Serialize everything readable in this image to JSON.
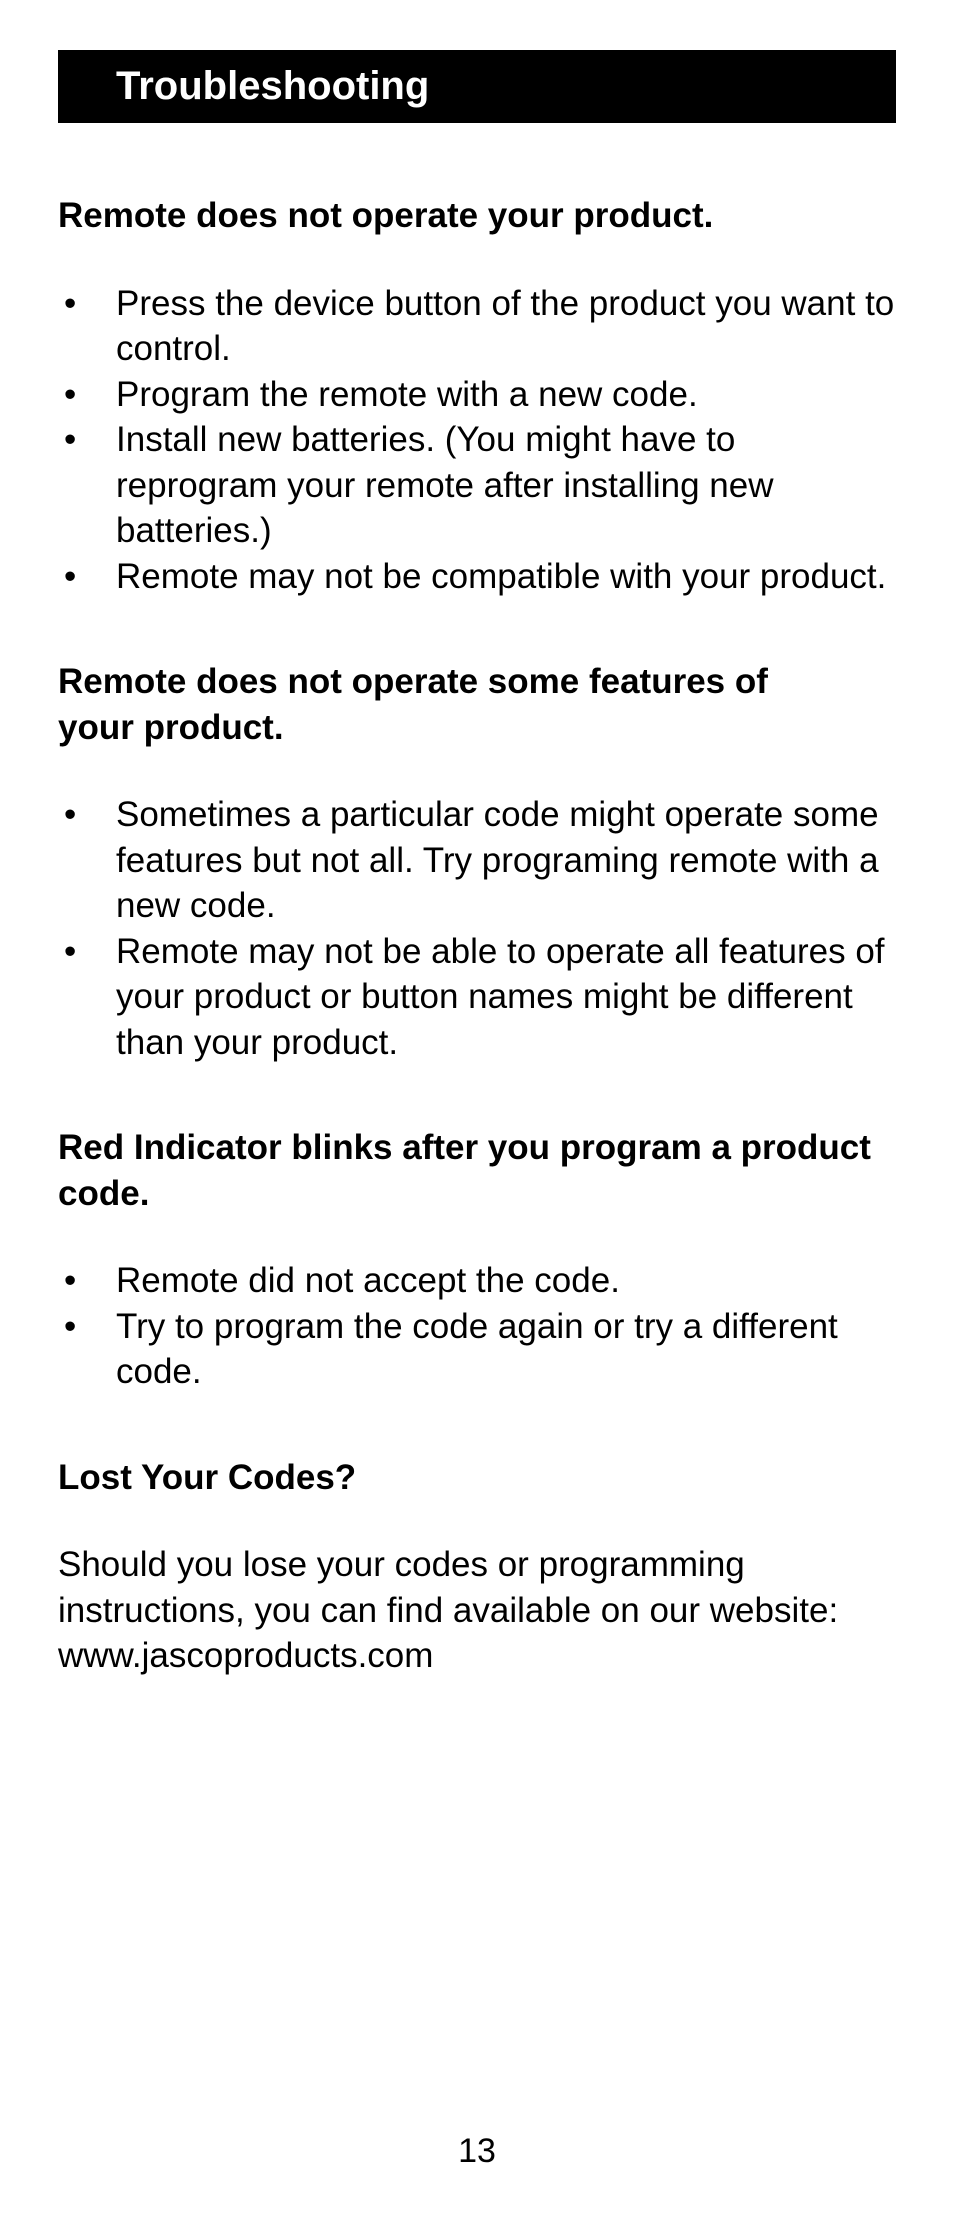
{
  "title": "Troubleshooting",
  "sections": [
    {
      "heading": "Remote does not operate your product.",
      "bullets": [
        "Press the device button of the product you want to control.",
        "Program the remote with a new code.",
        "Install new batteries. (You might have to reprogram your remote after installing new batteries.)",
        "Remote may not be compatible with your product."
      ]
    },
    {
      "heading": "Remote does not operate some features of\n your product.",
      "bullets": [
        "Sometimes a particular code might operate some features but not all. Try programing remote with a new code.",
        "Remote may not be able to operate all features of your product or button names might be different than your product."
      ]
    },
    {
      "heading": "Red Indicator blinks after you program a product code.",
      "bullets": [
        "Remote did not accept the code.",
        "Try to program the code again or try a different code."
      ]
    }
  ],
  "lost_heading": "Lost Your Codes?",
  "lost_body": "Should you lose your codes or programming instructions, you can find available on our website: www.jascoproducts.com",
  "page_number": "13"
}
